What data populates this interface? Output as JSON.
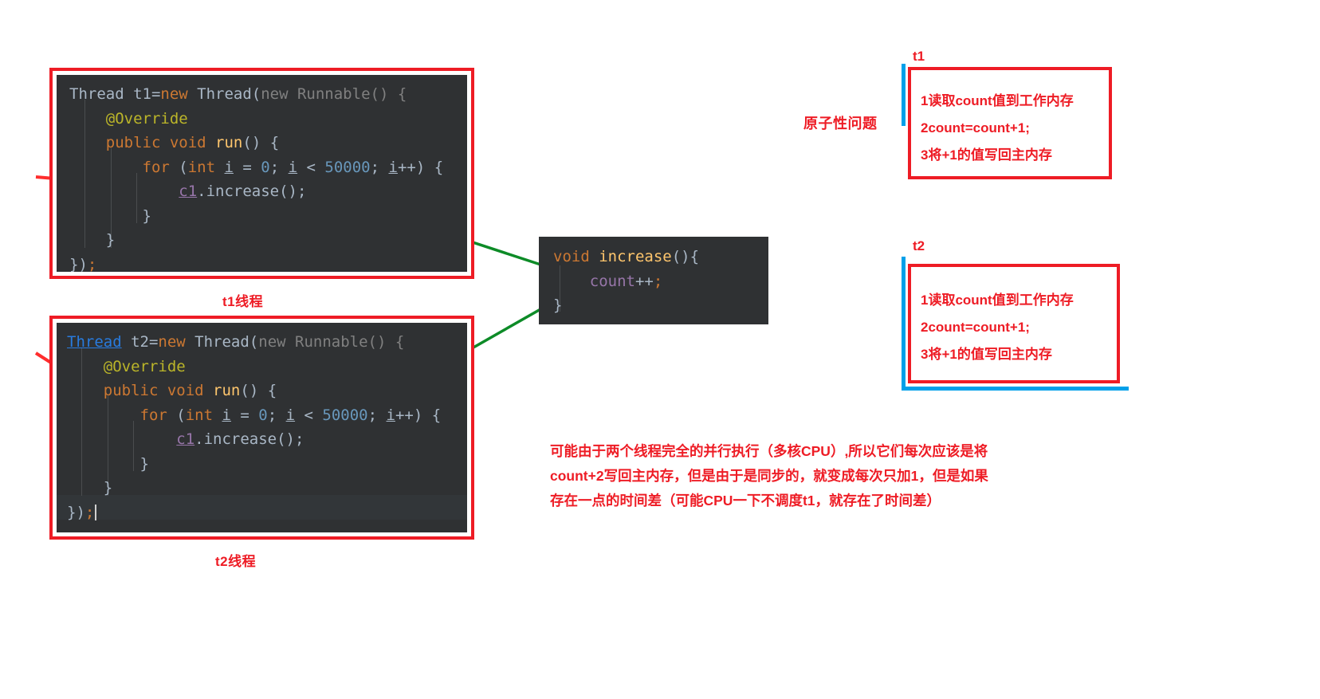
{
  "code_block_t1": {
    "caption": "t1线程",
    "lines": [
      "Thread t1=new Thread(new Runnable() {",
      "    @Override",
      "    public void run() {",
      "        for (int i = 0; i < 50000; i++) {",
      "            c1.increase();",
      "        }",
      "    }",
      "});"
    ]
  },
  "code_block_t2": {
    "caption": "t2线程",
    "lines": [
      "Thread t2=new Thread(new Runnable() {",
      "    @Override",
      "    public void run() {",
      "        for (int i = 0; i < 50000; i++) {",
      "            c1.increase();",
      "        }",
      "    }",
      "});"
    ]
  },
  "code_block_increase": {
    "lines": [
      "void increase(){",
      "    count++;",
      "}"
    ]
  },
  "atomicity_label": "原子性问题",
  "note_t1": {
    "tag": "t1",
    "lines": [
      "1读取count值到工作内存",
      "2count=count+1;",
      "3将+1的值写回主内存"
    ]
  },
  "note_t2": {
    "tag": "t2",
    "lines": [
      "1读取count值到工作内存",
      "2count=count+1;",
      "3将+1的值写回主内存"
    ]
  },
  "explanation": [
    "可能由于两个线程完全的并行执行（多核CPU）,所以它们每次应该是将",
    "count+2写回主内存，但是由于是同步的，就变成每次只加1，但是如果",
    "存在一点的时间差（可能CPU一下不调度t1，就存在了时间差）"
  ],
  "colors": {
    "red": "#ee1c25",
    "cyan": "#00a0e9",
    "green": "#0d8b27",
    "editor_bg": "#2f3133"
  }
}
